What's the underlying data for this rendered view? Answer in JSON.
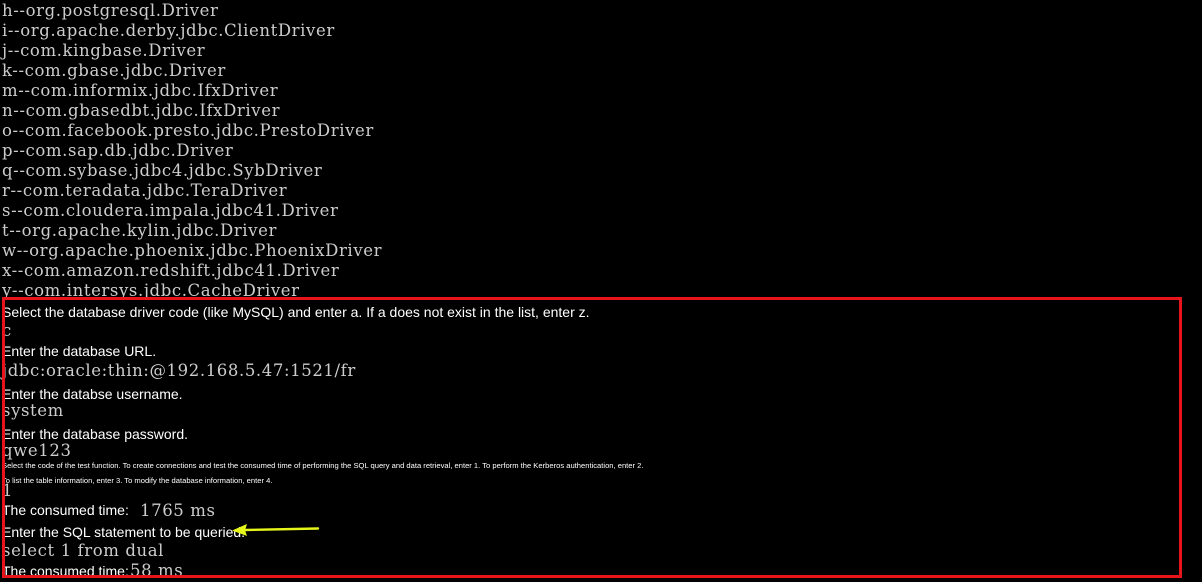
{
  "driver_list": [
    "h--org.postgresql.Driver",
    "i--org.apache.derby.jdbc.ClientDriver",
    "j--com.kingbase.Driver",
    "k--com.gbase.jdbc.Driver",
    "m--com.informix.jdbc.IfxDriver",
    "n--com.gbasedbt.jdbc.IfxDriver",
    "o--com.facebook.presto.jdbc.PrestoDriver",
    "p--com.sap.db.jdbc.Driver",
    "q--com.sybase.jdbc4.jdbc.SybDriver",
    "r--com.teradata.jdbc.TeraDriver",
    "s--com.cloudera.impala.jdbc41.Driver",
    "t--org.apache.kylin.jdbc.Driver",
    "w--org.apache.phoenix.jdbc.PhoenixDriver",
    "x--com.amazon.redshift.jdbc41.Driver",
    "y--com.intersys.jdbc.CacheDriver"
  ],
  "annotations": {
    "select_driver": "Select the database driver code (like MySQL) and enter a. If a does not exist in the list, enter z.",
    "enter_url": "Enter the database URL.",
    "enter_username": "Enter the databse username.",
    "enter_password": "Enter the database password.",
    "select_function_1": "Select the code of the test function. To create connections and test the consumed time of performing the SQL query and data retrieval, enter 1. To perform the Kerberos authentication, enter 2.",
    "select_function_2": "To list the table information, enter 3. To modify the database information, enter 4.",
    "consumed_time_1": "The consumed time:",
    "enter_sql": "Enter the SQL statement to be queried.",
    "consumed_time_2": "The consumed time:"
  },
  "inputs": {
    "driver_code": "c",
    "url": "jdbc:oracle:thin:@192.168.5.47:1521/fr",
    "username": "system",
    "password": "qwe123",
    "function_code": "1",
    "sql": "select 1 from dual"
  },
  "outputs": {
    "time_1": "1765 ms",
    "time_2": "58 ms"
  },
  "colors": {
    "background": "#000000",
    "console_text": "#cccccc",
    "annotation_text": "#ffffff",
    "highlight_border": "#e8141b",
    "arrow": "#e6f51a"
  }
}
